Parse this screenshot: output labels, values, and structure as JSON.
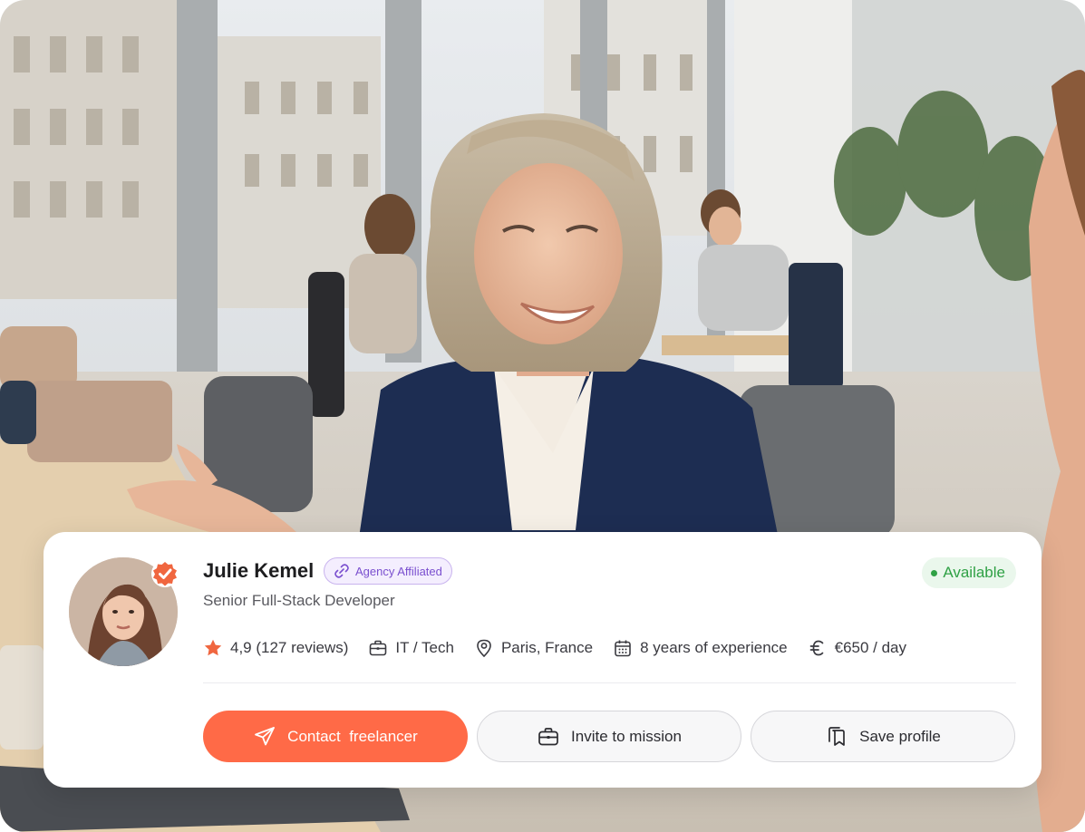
{
  "background": {
    "description_icon": "office-meeting-photo"
  },
  "profile": {
    "name": "Julie Kemel",
    "badge": "Agency Affiliated",
    "title": "Senior Full-Stack Developer",
    "status": "Available",
    "rating": "4,9 (127 reviews)",
    "category": "IT / Tech",
    "location": "Paris, France",
    "experience": "8 years of experience",
    "rate": "€650 / day"
  },
  "actions": {
    "contact": "Contact  freelancer",
    "invite": "Invite to mission",
    "save": "Save profile"
  },
  "colors": {
    "accent": "#ff6a47",
    "badge_purple": "#7a4fcf",
    "available_green": "#2fa145",
    "verified_orange": "#f0663f"
  }
}
